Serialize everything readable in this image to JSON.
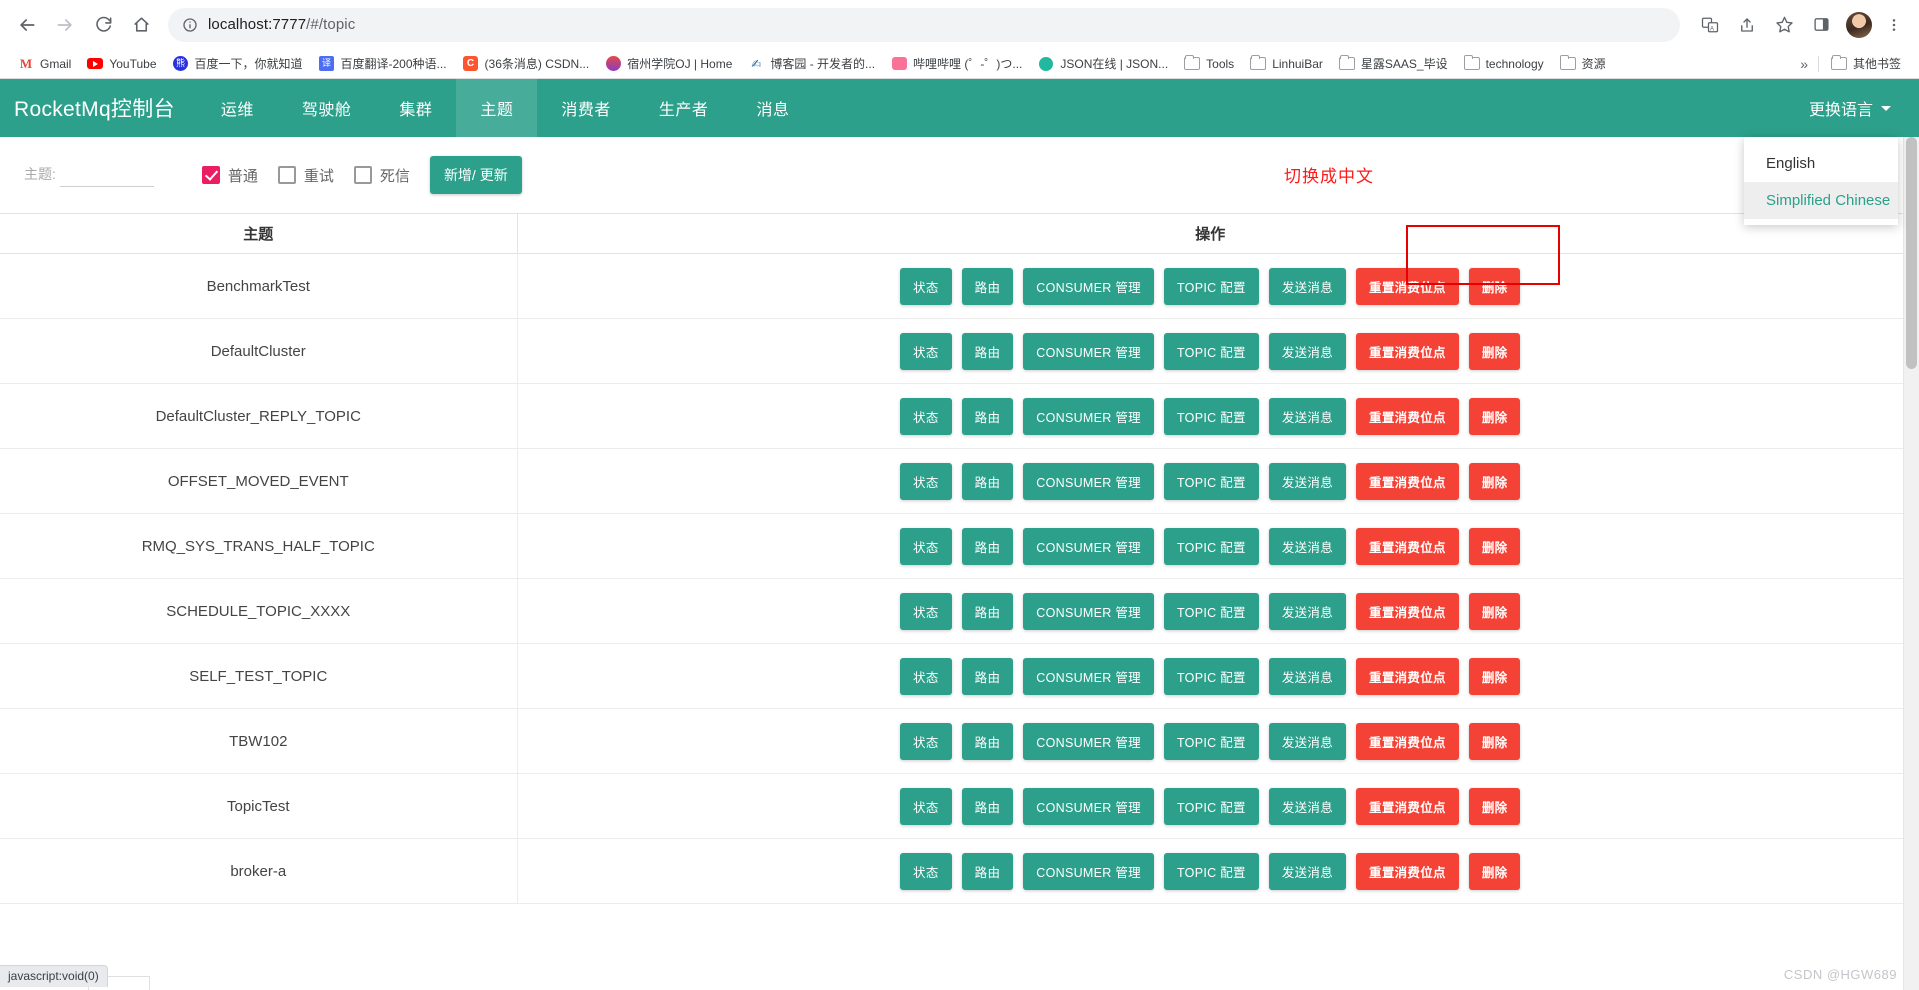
{
  "browser": {
    "url_host": "localhost:7777",
    "url_path": "/#/topic",
    "back_icon": "back-arrow-icon",
    "forward_icon": "forward-arrow-icon",
    "reload_icon": "reload-icon",
    "home_icon": "home-icon",
    "info_icon": "site-info-icon",
    "translate_icon": "translate-icon",
    "share_icon": "share-icon",
    "bookmark_icon": "star-icon",
    "sidepanel_icon": "side-panel-icon",
    "menu_icon": "kebab-menu-icon",
    "bookmarks": [
      {
        "label": "Gmail",
        "icon": "gmail-icon"
      },
      {
        "label": "YouTube",
        "icon": "youtube-icon"
      },
      {
        "label": "百度一下，你就知道",
        "icon": "baidu-icon"
      },
      {
        "label": "百度翻译-200种语...",
        "icon": "baidu-fanyi-icon"
      },
      {
        "label": "(36条消息) CSDN...",
        "icon": "csdn-icon"
      },
      {
        "label": "宿州学院OJ | Home",
        "icon": "oj-icon"
      },
      {
        "label": "博客园 - 开发者的...",
        "icon": "cnblogs-icon"
      },
      {
        "label": "哔哩哔哩 (゜-゜)つ...",
        "icon": "bilibili-icon"
      },
      {
        "label": "JSON在线 | JSON...",
        "icon": "json-icon"
      },
      {
        "label": "Tools",
        "icon": "folder-icon"
      },
      {
        "label": "LinhuiBar",
        "icon": "folder-icon"
      },
      {
        "label": "星露SAAS_毕设",
        "icon": "folder-icon"
      },
      {
        "label": "technology",
        "icon": "folder-icon"
      },
      {
        "label": "资源",
        "icon": "folder-icon"
      }
    ],
    "overflow_label": "»",
    "other_bookmarks": {
      "label": "其他书签",
      "icon": "folder-icon"
    }
  },
  "app": {
    "brand": "RocketMq控制台",
    "nav_tabs": [
      {
        "label": "运维",
        "active": false
      },
      {
        "label": "驾驶舱",
        "active": false
      },
      {
        "label": "集群",
        "active": false
      },
      {
        "label": "主题",
        "active": true
      },
      {
        "label": "消费者",
        "active": false
      },
      {
        "label": "生产者",
        "active": false
      },
      {
        "label": "消息",
        "active": false
      }
    ],
    "language_toggle": "更换语言",
    "language_menu": {
      "items": [
        {
          "label": "English",
          "selected": false
        },
        {
          "label": "Simplified Chinese",
          "selected": true
        }
      ]
    },
    "accent_color": "#2CA08B",
    "danger_color": "#F44336",
    "checkbox_color": "#e91e63",
    "annotation_color": "#e60000"
  },
  "filter": {
    "topic_label": "主题:",
    "topic_value": "",
    "topic_placeholder": "",
    "checkboxes": [
      {
        "label": "普通",
        "checked": true
      },
      {
        "label": "重试",
        "checked": false
      },
      {
        "label": "死信",
        "checked": false
      }
    ],
    "add_update_button": "新增/ 更新",
    "switch_hint": "切换成中文"
  },
  "table": {
    "columns": [
      "主题",
      "操作"
    ],
    "actions": [
      {
        "label": "状态",
        "style": "primary"
      },
      {
        "label": "路由",
        "style": "primary"
      },
      {
        "label": "CONSUMER 管理",
        "style": "primary"
      },
      {
        "label": "TOPIC 配置",
        "style": "primary"
      },
      {
        "label": "发送消息",
        "style": "primary"
      },
      {
        "label": "重置消费位点",
        "style": "danger"
      },
      {
        "label": "删除",
        "style": "danger"
      }
    ],
    "rows": [
      {
        "topic": "BenchmarkTest"
      },
      {
        "topic": "DefaultCluster"
      },
      {
        "topic": "DefaultCluster_REPLY_TOPIC"
      },
      {
        "topic": "OFFSET_MOVED_EVENT"
      },
      {
        "topic": "RMQ_SYS_TRANS_HALF_TOPIC"
      },
      {
        "topic": "SCHEDULE_TOPIC_XXXX"
      },
      {
        "topic": "SELF_TEST_TOPIC"
      },
      {
        "topic": "TBW102"
      },
      {
        "topic": "TopicTest"
      },
      {
        "topic": "broker-a"
      }
    ]
  },
  "status": {
    "link_preview": "javascript:void(0)",
    "watermark": "CSDN @HGW689"
  }
}
